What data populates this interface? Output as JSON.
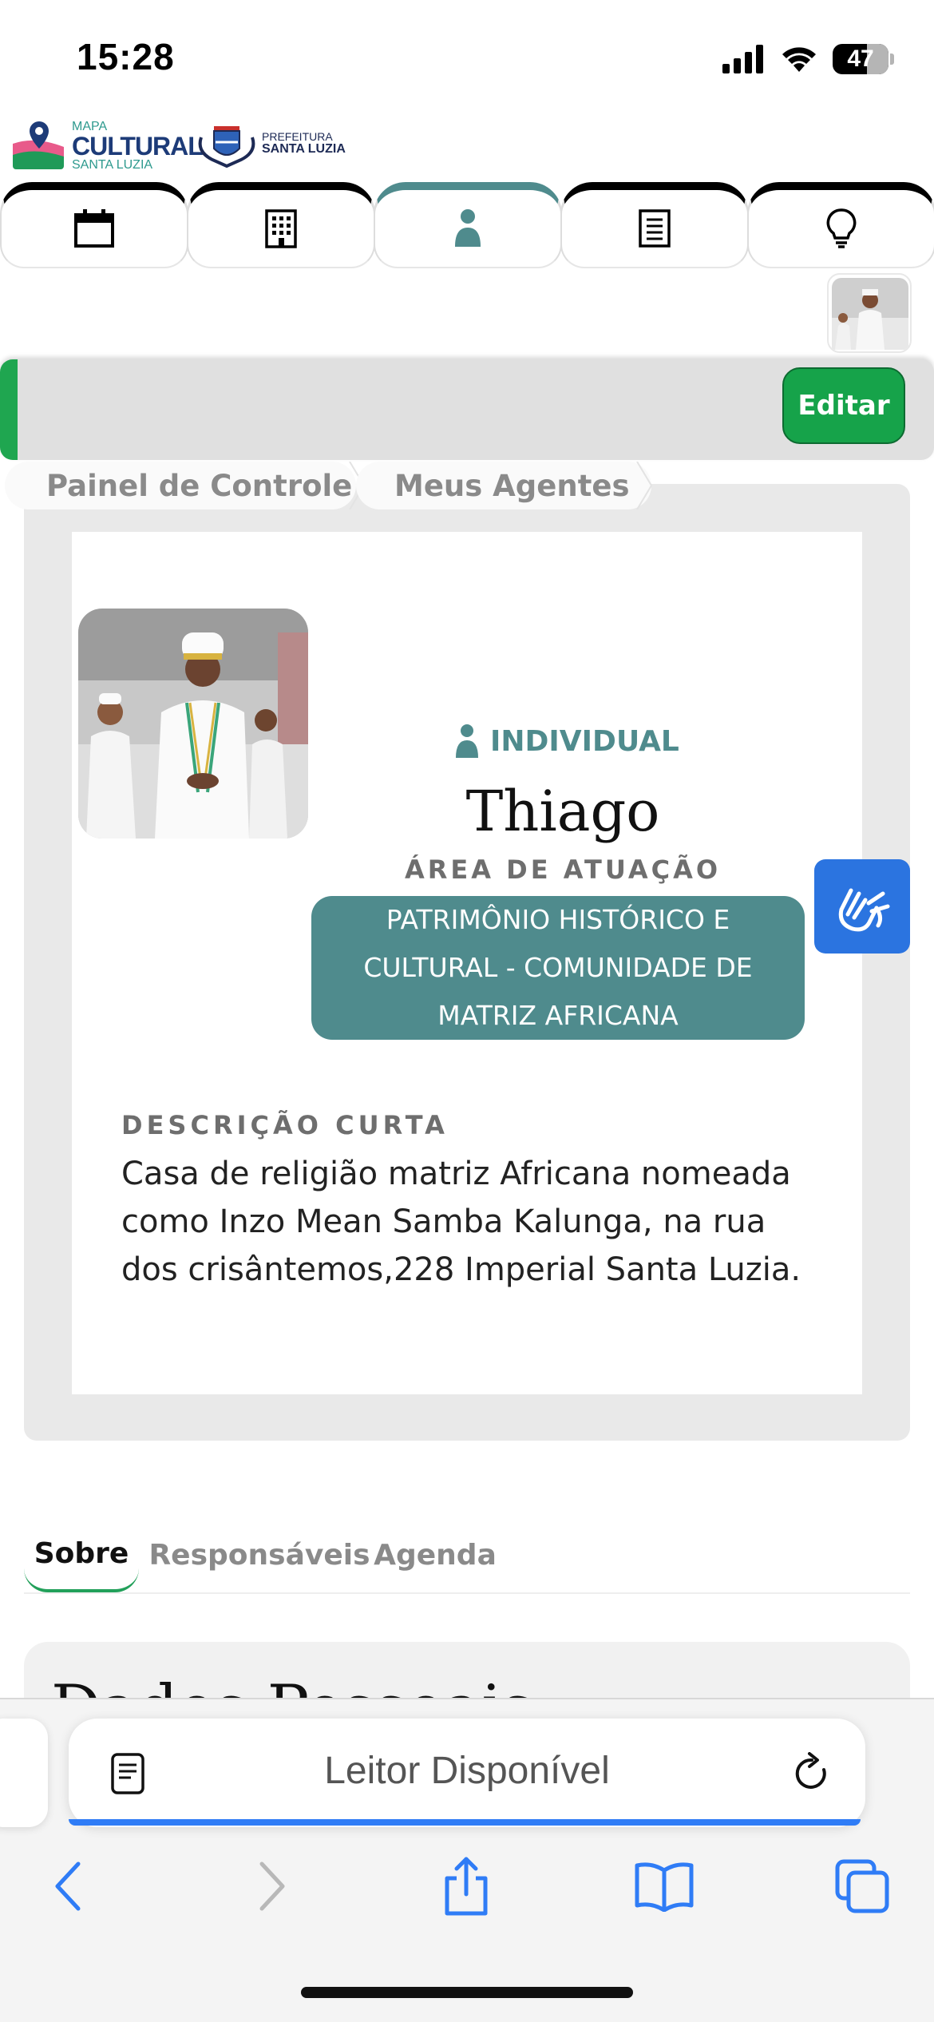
{
  "status_bar": {
    "time": "15:28",
    "battery": "47"
  },
  "logos": {
    "mapa_small": "MAPA",
    "mapa_big": "CULTURAL",
    "mapa_sub": "SANTA LUZIA",
    "prefeitura_small": "PREFEITURA",
    "prefeitura_big": "SANTA LUZIA"
  },
  "nav_tabs": [
    {
      "icon": "calendar-icon",
      "active": false
    },
    {
      "icon": "building-icon",
      "active": false
    },
    {
      "icon": "person-icon",
      "active": true
    },
    {
      "icon": "document-icon",
      "active": false
    },
    {
      "icon": "lightbulb-icon",
      "active": false
    }
  ],
  "toolbar": {
    "edit_label": "Editar"
  },
  "breadcrumb": [
    "Painel de Controle",
    "Meus Agentes"
  ],
  "profile": {
    "type": "INDIVIDUAL",
    "name": "Thiago",
    "area_label": "ÁREA DE ATUAÇÃO",
    "area_lines": [
      "PATRIMÔNIO HISTÓRICO E",
      "CULTURAL - COMUNIDADE DE",
      "MATRIZ AFRICANA"
    ],
    "desc_label": "DESCRIÇÃO CURTA",
    "desc_text": "Casa de religião matriz Africana nomeada como Inzo Mean Samba Kalunga, na rua dos crisântemos,228 Imperial Santa Luzia."
  },
  "content_tabs": [
    "Sobre",
    "Responsáveis",
    "Agenda"
  ],
  "section": {
    "title": "Dados Pessoais"
  },
  "browser": {
    "address_text": "Leitor Disponível"
  },
  "colors": {
    "accent_teal": "#4f8b8d",
    "edit_green": "#16a34a",
    "safari_blue": "#2f7cf6",
    "accessibility_blue": "#2b74e0"
  }
}
